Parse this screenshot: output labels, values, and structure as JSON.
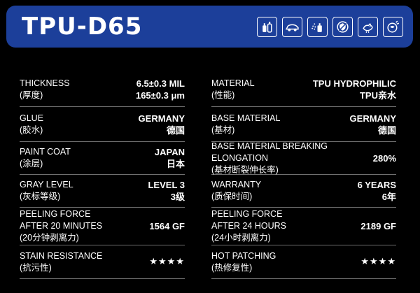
{
  "header": {
    "title": "TPU-D65",
    "icons": [
      "bottle-icon",
      "car-icon",
      "paint-spray-icon",
      "shield-icon",
      "bird-icon",
      "heat-repair-icon"
    ]
  },
  "left": [
    {
      "label": [
        "THICKNESS",
        "(厚度)"
      ],
      "value": [
        "6.5±0.3 MIL",
        "165±0.3 μm"
      ]
    },
    {
      "label": [
        "GLUE",
        "(胶水)"
      ],
      "value": [
        "GERMANY",
        "德国"
      ]
    },
    {
      "label": [
        "PAINT COAT",
        "(涂层)"
      ],
      "value": [
        "JAPAN",
        "日本"
      ]
    },
    {
      "label": [
        "GRAY LEVEL",
        "(灰标等级)"
      ],
      "value": [
        "LEVEL 3",
        "3级"
      ]
    },
    {
      "label": [
        "PEELING FORCE",
        "AFTER 20 MINUTES",
        "(20分钟剥离力)"
      ],
      "value": [
        "1564 GF"
      ]
    },
    {
      "label": [
        "STAIN RESISTANCE",
        "(抗污性)"
      ],
      "value": [
        "★★★★"
      ]
    }
  ],
  "right": [
    {
      "label": [
        "MATERIAL",
        "(性能)"
      ],
      "value": [
        "TPU HYDROPHILIC",
        "TPU亲水"
      ]
    },
    {
      "label": [
        "BASE MATERIAL",
        "(基材)"
      ],
      "value": [
        "GERMANY",
        "德国"
      ]
    },
    {
      "label": [
        "BASE MATERIAL BREAKING",
        "ELONGATION",
        "(基材断裂伸长率)"
      ],
      "value": [
        "280%"
      ]
    },
    {
      "label": [
        "WARRANTY",
        "(质保时间)"
      ],
      "value": [
        "6 YEARS",
        "6年"
      ]
    },
    {
      "label": [
        "PEELING FORCE",
        "AFTER 24 HOURS",
        "(24小时剥离力)"
      ],
      "value": [
        "2189 GF"
      ]
    },
    {
      "label": [
        "HOT PATCHING",
        "(热修复性)"
      ],
      "value": [
        "★★★★"
      ]
    }
  ],
  "colors": {
    "header_bg": "#1c3f9a",
    "background": "#000000",
    "divider": "#6f6f6f",
    "text": "#ffffff"
  }
}
